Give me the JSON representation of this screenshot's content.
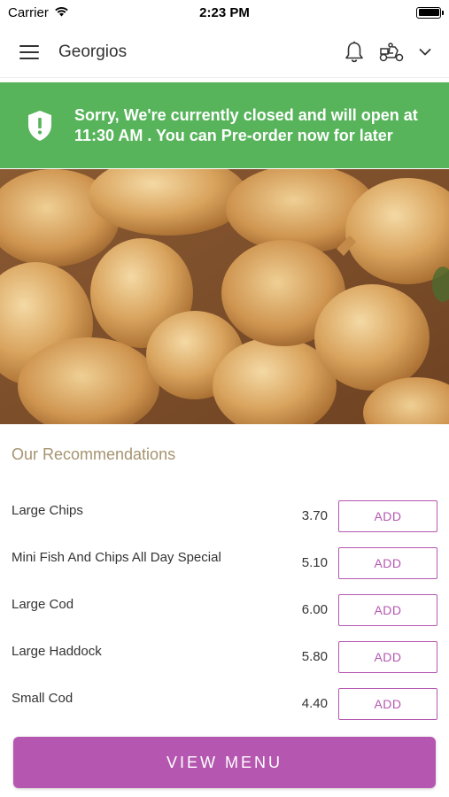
{
  "status_bar": {
    "carrier": "Carrier",
    "time": "2:23 PM"
  },
  "nav": {
    "title": "Georgios",
    "icons": [
      "menu-icon",
      "bell-icon",
      "scooter-icon",
      "chevron-down-icon"
    ]
  },
  "banner": {
    "icon": "shield-alert-icon",
    "message": "Sorry, We're currently closed and will open at 11:30 AM . You can Pre-order now for later",
    "color": "#57b45b"
  },
  "hero": {
    "icon": "fried-chicken-photo"
  },
  "recommendations": {
    "title": "Our Recommendations",
    "items": [
      {
        "name": "Large Chips",
        "price": "3.70",
        "action": "ADD"
      },
      {
        "name": "Mini Fish And Chips All Day Special",
        "price": "5.10",
        "action": "ADD"
      },
      {
        "name": "Large Cod",
        "price": "6.00",
        "action": "ADD"
      },
      {
        "name": "Large Haddock",
        "price": "5.80",
        "action": "ADD"
      },
      {
        "name": "Small Cod",
        "price": "4.40",
        "action": "ADD"
      }
    ]
  },
  "view_menu": {
    "label": "VIEW MENU",
    "color": "#b557b0"
  }
}
